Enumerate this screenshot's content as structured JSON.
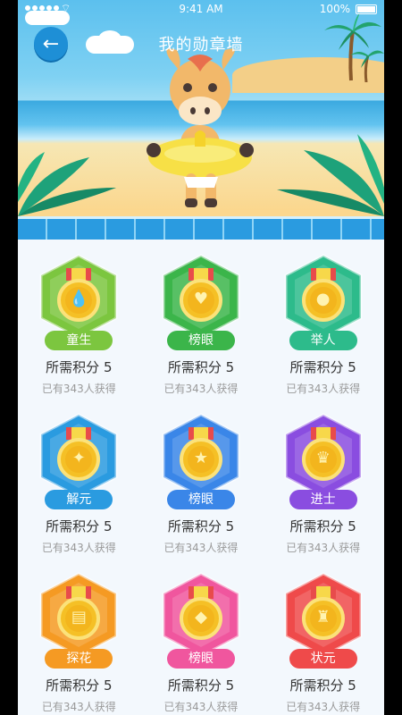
{
  "status_bar": {
    "time": "9:41 AM",
    "battery": "100%"
  },
  "header": {
    "title": "我的勋章墙",
    "back_icon": "arrow-left-icon"
  },
  "colors": {
    "green_light": "#7cc63f",
    "green": "#3bb54a",
    "teal": "#2dbb8b",
    "sky": "#2a9be0",
    "blue": "#3a86e8",
    "purple": "#8a4de0",
    "orange": "#f59a23",
    "pink": "#f0569e",
    "red": "#ef4a4a"
  },
  "badges": [
    {
      "name": "童生",
      "points_label": "所需积分 5",
      "earned_label": "已有343人获得",
      "theme": "green_light",
      "icon": "drop-icon"
    },
    {
      "name": "榜眼",
      "points_label": "所需积分 5",
      "earned_label": "已有343人获得",
      "theme": "green",
      "icon": "heart-icon"
    },
    {
      "name": "举人",
      "points_label": "所需积分 5",
      "earned_label": "已有343人获得",
      "theme": "teal",
      "icon": "circle-icon"
    },
    {
      "name": "解元",
      "points_label": "所需积分 5",
      "earned_label": "已有343人获得",
      "theme": "sky",
      "icon": "sparkle-icon"
    },
    {
      "name": "榜眼",
      "points_label": "所需积分 5",
      "earned_label": "已有343人获得",
      "theme": "blue",
      "icon": "star-icon"
    },
    {
      "name": "进士",
      "points_label": "所需积分 5",
      "earned_label": "已有343人获得",
      "theme": "purple",
      "icon": "crown-icon"
    },
    {
      "name": "探花",
      "points_label": "所需积分 5",
      "earned_label": "已有343人获得",
      "theme": "orange",
      "icon": "book-icon"
    },
    {
      "name": "榜眼",
      "points_label": "所需积分 5",
      "earned_label": "已有343人获得",
      "theme": "pink",
      "icon": "graduation-cap-icon"
    },
    {
      "name": "状元",
      "points_label": "所需积分 5",
      "earned_label": "已有343人获得",
      "theme": "red",
      "icon": "trophy-icon"
    }
  ]
}
